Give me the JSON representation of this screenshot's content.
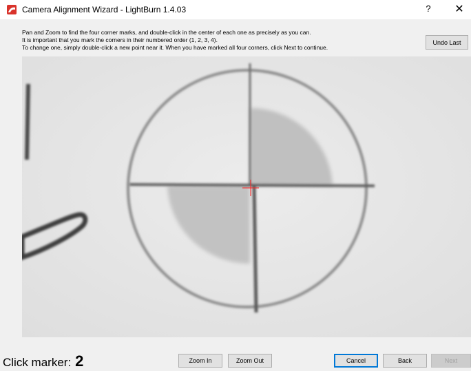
{
  "window": {
    "title": "Camera Alignment Wizard - LightBurn 1.4.03",
    "help_label": "?",
    "close_label": "✕"
  },
  "instructions": {
    "line1": "Pan and Zoom to find the four corner marks, and double-click in the center of each one as precisely as you can.",
    "line2": "It is important that you mark the corners in their numbered order (1, 2, 3, 4).",
    "line3": "To change one, simply double-click a new point near it.  When you have marked all four corners, click Next to continue."
  },
  "buttons": {
    "undo_last": "Undo Last",
    "zoom_in": "Zoom In",
    "zoom_out": "Zoom Out",
    "cancel": "Cancel",
    "back": "Back",
    "next": "Next"
  },
  "status": {
    "label": "Click marker:",
    "marker_number": "2"
  },
  "colors": {
    "cursor_crosshair": "#ff2020",
    "app_icon": "#d9332b"
  },
  "icons": {
    "app": "lightburn-app-icon",
    "help": "help-icon",
    "close": "close-icon",
    "crosshair": "crosshair-cursor-icon"
  }
}
